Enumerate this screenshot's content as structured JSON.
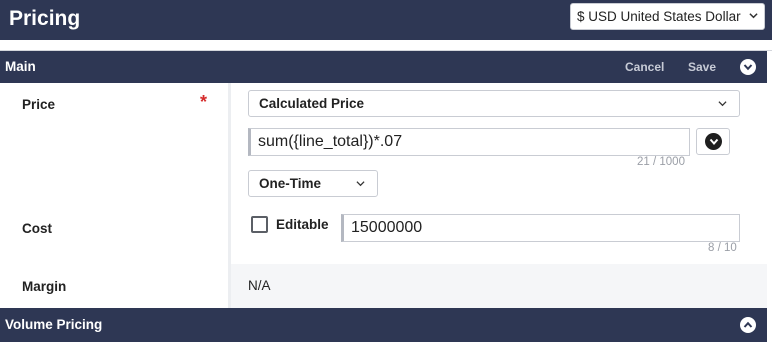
{
  "header": {
    "title": "Pricing",
    "currency_selected": "$ USD United States Dollar"
  },
  "main_section": {
    "title": "Main",
    "cancel_label": "Cancel",
    "save_label": "Save"
  },
  "fields": {
    "price": {
      "label": "Price",
      "required_marker": "*",
      "price_type": "Calculated Price",
      "formula": "sum({line_total})*.07",
      "formula_counter": "21 / 1000",
      "frequency": "One-Time"
    },
    "cost": {
      "label": "Cost",
      "editable_label": "Editable",
      "editable_checked": false,
      "value": "15000000",
      "counter": "8 / 10"
    },
    "margin": {
      "label": "Margin",
      "value": "N/A"
    }
  },
  "volume_section": {
    "title": "Volume Pricing"
  },
  "colors": {
    "header_bg": "#2e3754",
    "required": "#d52a2a"
  }
}
